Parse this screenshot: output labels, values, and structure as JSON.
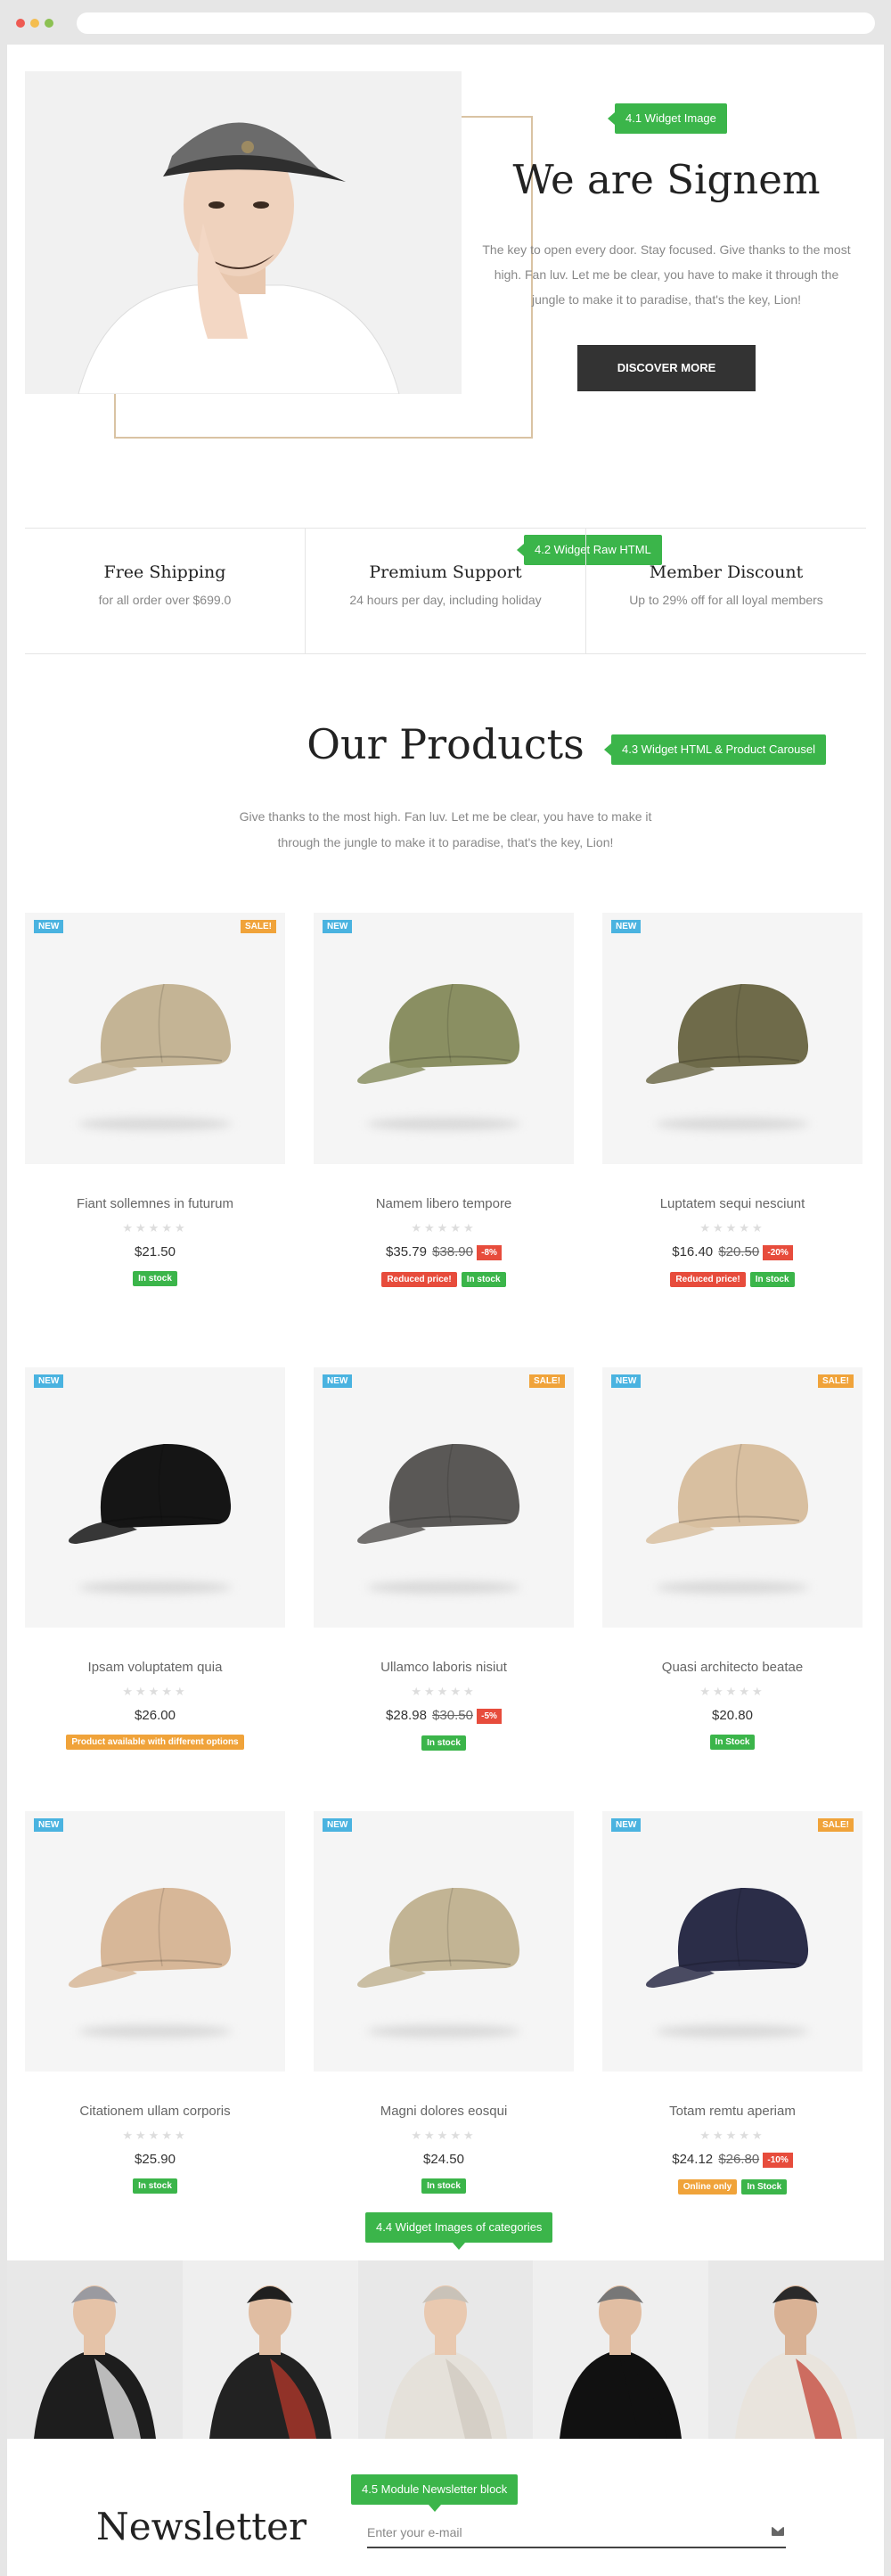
{
  "hero": {
    "tag": "4.1 Widget Image",
    "title": "We are Signem",
    "text": "The key to open every door. Stay focused. Give thanks to the most high. Fan luv. Let me be clear, you have to make it through the jungle to make it to paradise, that's the key, Lion!",
    "button": "DISCOVER MORE"
  },
  "features": {
    "tag": "4.2 Widget Raw HTML",
    "items": [
      {
        "title": "Free Shipping",
        "sub": "for all order over $699.0"
      },
      {
        "title": "Premium Support",
        "sub": "24 hours per day, including holiday"
      },
      {
        "title": "Member Discount",
        "sub": "Up to 29% off for all loyal members"
      }
    ]
  },
  "products": {
    "tag": "4.3 Widget HTML & Product Carousel",
    "title": "Our Products",
    "subtitle": "Give thanks to the most high. Fan luv. Let me be clear, you have to make it through the jungle to make it to paradise, that's the key, Lion!",
    "badge_new": "NEW",
    "badge_sale": "SALE!",
    "items": [
      {
        "name": "Fiant sollemnes in futurum",
        "price": "$21.50",
        "old": "",
        "discount": "",
        "labels": [
          "In stock"
        ],
        "color": "#c4b495"
      },
      {
        "name": "Namem libero tempore",
        "price": "$35.79",
        "old": "$38.90",
        "discount": "-8%",
        "labels": [
          "Reduced price!",
          "In stock"
        ],
        "color": "#8a8f62"
      },
      {
        "name": "Luptatem sequi nesciunt",
        "price": "$16.40",
        "old": "$20.50",
        "discount": "-20%",
        "labels": [
          "Reduced price!",
          "In stock"
        ],
        "color": "#6f6b4a"
      },
      {
        "name": "Ipsam voluptatem quia",
        "price": "$26.00",
        "old": "",
        "discount": "",
        "labels": [
          "Product available with different options"
        ],
        "color": "#151515"
      },
      {
        "name": "Ullamco laboris nisiut",
        "price": "$28.98",
        "old": "$30.50",
        "discount": "-5%",
        "labels": [
          "In stock"
        ],
        "color": "#5a5856"
      },
      {
        "name": "Quasi architecto beatae",
        "price": "$20.80",
        "old": "",
        "discount": "",
        "labels": [
          "In Stock"
        ],
        "color": "#d8bfa0"
      },
      {
        "name": "Citationem ullam corporis",
        "price": "$25.90",
        "old": "",
        "discount": "",
        "labels": [
          "In stock"
        ],
        "color": "#d7b798"
      },
      {
        "name": "Magni dolores eosqui",
        "price": "$24.50",
        "old": "",
        "discount": "",
        "labels": [
          "In stock"
        ],
        "color": "#c2b494"
      },
      {
        "name": "Totam remtu aperiam",
        "price": "$24.12",
        "old": "$26.80",
        "discount": "-10%",
        "labels": [
          "Online only",
          "In Stock"
        ],
        "color": "#2b2d48"
      }
    ],
    "sale_flags": [
      true,
      false,
      false,
      false,
      true,
      true,
      false,
      false,
      true
    ]
  },
  "categories": {
    "tag": "4.4 Widget Images of categories",
    "count": 5
  },
  "newsletter": {
    "tag": "4.5 Module Newsletter block",
    "title": "Newsletter",
    "placeholder": "Enter your e-mail"
  }
}
